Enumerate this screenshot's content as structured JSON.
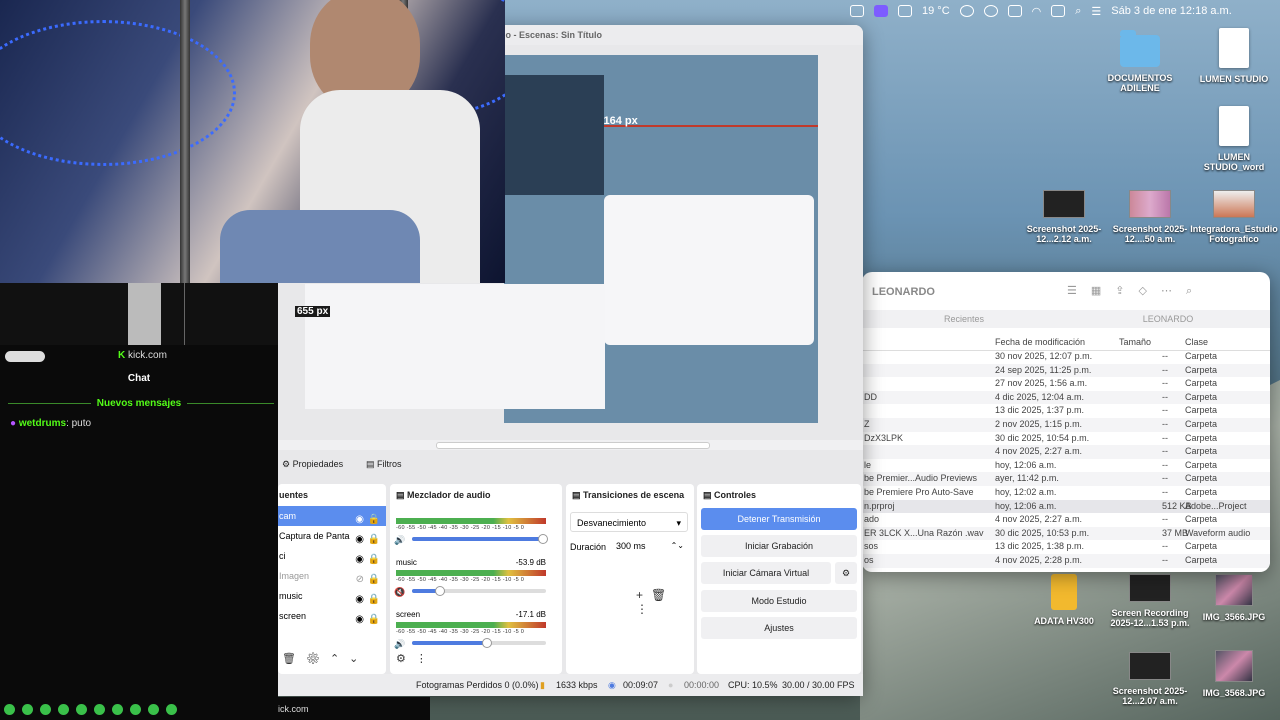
{
  "menubar": {
    "weather": "19 °C",
    "datetime": "Sáb 3 de ene  12:18 a.m."
  },
  "desktop_icons": [
    {
      "label": "DOCUMENTOS ADILENE",
      "kind": "folder"
    },
    {
      "label": "LUMEN STUDIO",
      "kind": "doc"
    },
    {
      "label": "LUMEN STUDIO_word",
      "kind": "doc"
    },
    {
      "label": "Screenshot 2025-12...2.12 a.m.",
      "kind": "thumb"
    },
    {
      "label": "Screenshot 2025-12....50 a.m.",
      "kind": "thumb-pink"
    },
    {
      "label": "Integradora_Estudio Fotografico",
      "kind": "thumb-brown"
    },
    {
      "label": "ADATA HV300",
      "kind": "drive"
    },
    {
      "label": "Screen Recording 2025-12...1.53 p.m.",
      "kind": "thumb"
    },
    {
      "label": "IMG_3566.JPG",
      "kind": "photo"
    },
    {
      "label": "Screenshot 2025-12...2.07 a.m.",
      "kind": "thumb"
    },
    {
      "label": "IMG_3568.JPG",
      "kind": "photo"
    }
  ],
  "finder": {
    "title": "LEONARDO",
    "tabs": [
      "Recientes",
      "LEONARDO"
    ],
    "columns": [
      "Fecha de modificación",
      "Tamaño",
      "Clase"
    ],
    "rows": [
      {
        "name": "",
        "date": "30 nov 2025, 12:07 p.m.",
        "size": "--",
        "kind": "Carpeta"
      },
      {
        "name": "",
        "date": "24 sep 2025, 11:25 p.m.",
        "size": "--",
        "kind": "Carpeta"
      },
      {
        "name": "",
        "date": "27 nov 2025, 1:56 a.m.",
        "size": "--",
        "kind": "Carpeta"
      },
      {
        "name": "DD",
        "date": "4 dic 2025, 12:04 a.m.",
        "size": "--",
        "kind": "Carpeta"
      },
      {
        "name": "",
        "date": "13 dic 2025, 1:37 p.m.",
        "size": "--",
        "kind": "Carpeta"
      },
      {
        "name": "Z",
        "date": "2 nov 2025, 1:15 p.m.",
        "size": "--",
        "kind": "Carpeta"
      },
      {
        "name": "DzX3LPK",
        "date": "30 dic 2025, 10:54 p.m.",
        "size": "--",
        "kind": "Carpeta"
      },
      {
        "name": "",
        "date": "4 nov 2025, 2:27 a.m.",
        "size": "--",
        "kind": "Carpeta"
      },
      {
        "name": "le",
        "date": "hoy, 12:06 a.m.",
        "size": "--",
        "kind": "Carpeta"
      },
      {
        "name": "be Premier...Audio Previews",
        "date": "ayer, 11:42 p.m.",
        "size": "--",
        "kind": "Carpeta"
      },
      {
        "name": "be Premiere Pro Auto-Save",
        "date": "hoy, 12:02 a.m.",
        "size": "--",
        "kind": "Carpeta"
      },
      {
        "name": "n.prproj",
        "date": "hoy, 12:06 a.m.",
        "size": "512 KB",
        "kind": "Adobe...Project"
      },
      {
        "name": "ado",
        "date": "4 nov 2025, 2:27 a.m.",
        "size": "--",
        "kind": "Carpeta"
      },
      {
        "name": "ER 3LCK X...Una Razón .wav",
        "date": "30 dic 2025, 10:53 p.m.",
        "size": "37 MB",
        "kind": "Waveform audio"
      },
      {
        "name": "sos",
        "date": "13 dic 2025, 1:38 p.m.",
        "size": "--",
        "kind": "Carpeta"
      },
      {
        "name": "os",
        "date": "4 nov 2025, 2:28 p.m.",
        "size": "--",
        "kind": "Carpeta"
      }
    ]
  },
  "obs": {
    "window_title": "lo - Escenas: Sin Título",
    "preview_measure": "1164 px",
    "preview_measure_v": "655 px",
    "props_button": "Propiedades",
    "filters_button": "Filtros",
    "sources_title": "uentes",
    "sources": [
      {
        "label": "cam",
        "visible": true,
        "selected": true
      },
      {
        "label": "Captura de Panta",
        "visible": true,
        "selected": false
      },
      {
        "label": "ci",
        "visible": true,
        "selected": false
      },
      {
        "label": "Imagen",
        "visible": false,
        "selected": false
      },
      {
        "label": "music",
        "visible": true,
        "selected": false
      },
      {
        "label": "screen",
        "visible": true,
        "selected": false
      }
    ],
    "mixer_title": "Mezclador de audio",
    "scale": "-60 -55 -50 -45 -40 -35 -30 -25 -20 -15 -10 -5 0",
    "channels": [
      {
        "name": "",
        "db": "",
        "volume": 0.97,
        "muted": false
      },
      {
        "name": "music",
        "db": "-53.9 dB",
        "volume": 0.2,
        "muted": true
      },
      {
        "name": "screen",
        "db": "-17.1 dB",
        "volume": 0.55,
        "muted": false
      }
    ],
    "transitions_title": "Transiciones de escena",
    "transition": "Desvanecimiento",
    "duration_label": "Duración",
    "duration": "300 ms",
    "controls_title": "Controles",
    "controls": {
      "stop_stream": "Detener Transmisión",
      "start_record": "Iniciar Grabación",
      "virtual_cam": "Iniciar Cámara Virtual",
      "studio_mode": "Modo Estudio",
      "settings": "Ajustes"
    },
    "status": {
      "dropped": "Fotogramas Perdidos 0 (0.0%)",
      "bitrate": "1633 kbps",
      "stream_time": "00:09:07",
      "record_time": "00:00:00",
      "cpu": "CPU: 10.5%",
      "fps": "30.00 / 30.00 FPS"
    }
  },
  "chat": {
    "site": "kick.com",
    "title": "Chat",
    "new_messages": "Nuevos mensajes",
    "messages": [
      {
        "user": "wetdrums",
        "text": "puto"
      }
    ],
    "footer_url": "ick.com"
  }
}
